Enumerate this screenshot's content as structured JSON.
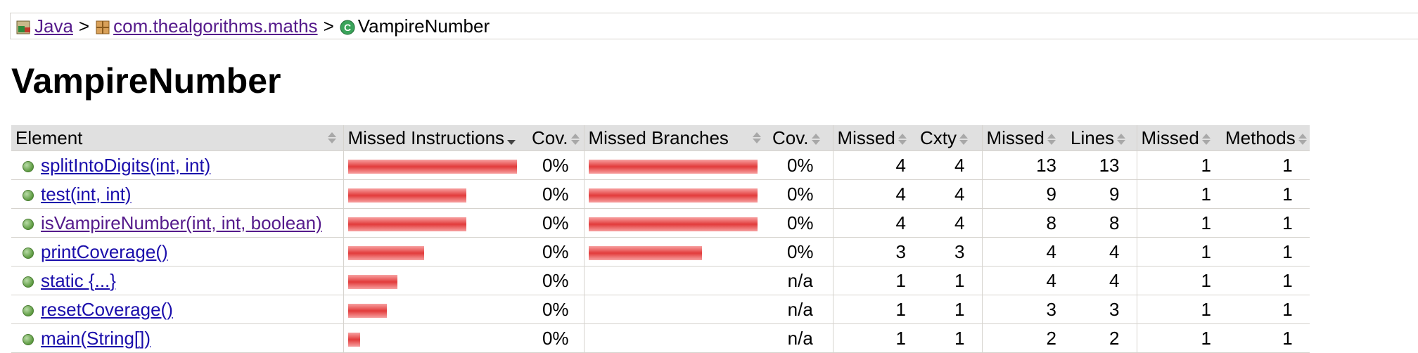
{
  "breadcrumb": {
    "root": "Java",
    "package": "com.thealgorithms.maths",
    "separator": ">",
    "current": "VampireNumber"
  },
  "title": "VampireNumber",
  "table": {
    "headers": {
      "element": "Element",
      "missed_instructions": "Missed Instructions",
      "cov1": "Cov.",
      "missed_branches": "Missed Branches",
      "cov2": "Cov.",
      "missed_cxty": "Missed",
      "cxty": "Cxty",
      "missed_lines": "Missed",
      "lines": "Lines",
      "missed_methods": "Missed",
      "methods": "Methods"
    },
    "rows": [
      {
        "name": "splitIntoDigits(int, int)",
        "instr_fraction": 1.0,
        "instr_cov": "0%",
        "branch_fraction": 1.0,
        "branch_cov": "0%",
        "missed_cxty": "4",
        "cxty": "4",
        "missed_lines": "13",
        "lines": "13",
        "missed_methods": "1",
        "methods": "1"
      },
      {
        "name": "test(int, int)",
        "instr_fraction": 0.7,
        "instr_cov": "0%",
        "branch_fraction": 1.0,
        "branch_cov": "0%",
        "missed_cxty": "4",
        "cxty": "4",
        "missed_lines": "9",
        "lines": "9",
        "missed_methods": "1",
        "methods": "1"
      },
      {
        "name": "isVampireNumber(int, int, boolean)",
        "instr_fraction": 0.7,
        "instr_cov": "0%",
        "branch_fraction": 1.0,
        "branch_cov": "0%",
        "missed_cxty": "4",
        "cxty": "4",
        "missed_lines": "8",
        "lines": "8",
        "missed_methods": "1",
        "methods": "1"
      },
      {
        "name": "printCoverage()",
        "instr_fraction": 0.45,
        "instr_cov": "0%",
        "branch_fraction": 0.67,
        "branch_cov": "0%",
        "missed_cxty": "3",
        "cxty": "3",
        "missed_lines": "4",
        "lines": "4",
        "missed_methods": "1",
        "methods": "1"
      },
      {
        "name": "static {...}",
        "instr_fraction": 0.29,
        "instr_cov": "0%",
        "branch_fraction": 0,
        "branch_cov": "n/a",
        "missed_cxty": "1",
        "cxty": "1",
        "missed_lines": "4",
        "lines": "4",
        "missed_methods": "1",
        "methods": "1"
      },
      {
        "name": "resetCoverage()",
        "instr_fraction": 0.23,
        "instr_cov": "0%",
        "branch_fraction": 0,
        "branch_cov": "n/a",
        "missed_cxty": "1",
        "cxty": "1",
        "missed_lines": "3",
        "lines": "3",
        "missed_methods": "1",
        "methods": "1"
      },
      {
        "name": "main(String[])",
        "instr_fraction": 0.07,
        "instr_cov": "0%",
        "branch_fraction": 0,
        "branch_cov": "n/a",
        "missed_cxty": "1",
        "cxty": "1",
        "missed_lines": "2",
        "lines": "2",
        "missed_methods": "1",
        "methods": "1"
      }
    ]
  },
  "colors": {
    "bar_red": "#e23b3b",
    "header_bg": "#e0e0e0",
    "link_visited": "#551a8b",
    "link": "#1a0dab"
  },
  "icons": {
    "root": "jar-icon",
    "package": "package-icon",
    "current": "class-icon",
    "method": "method-dot-icon"
  }
}
